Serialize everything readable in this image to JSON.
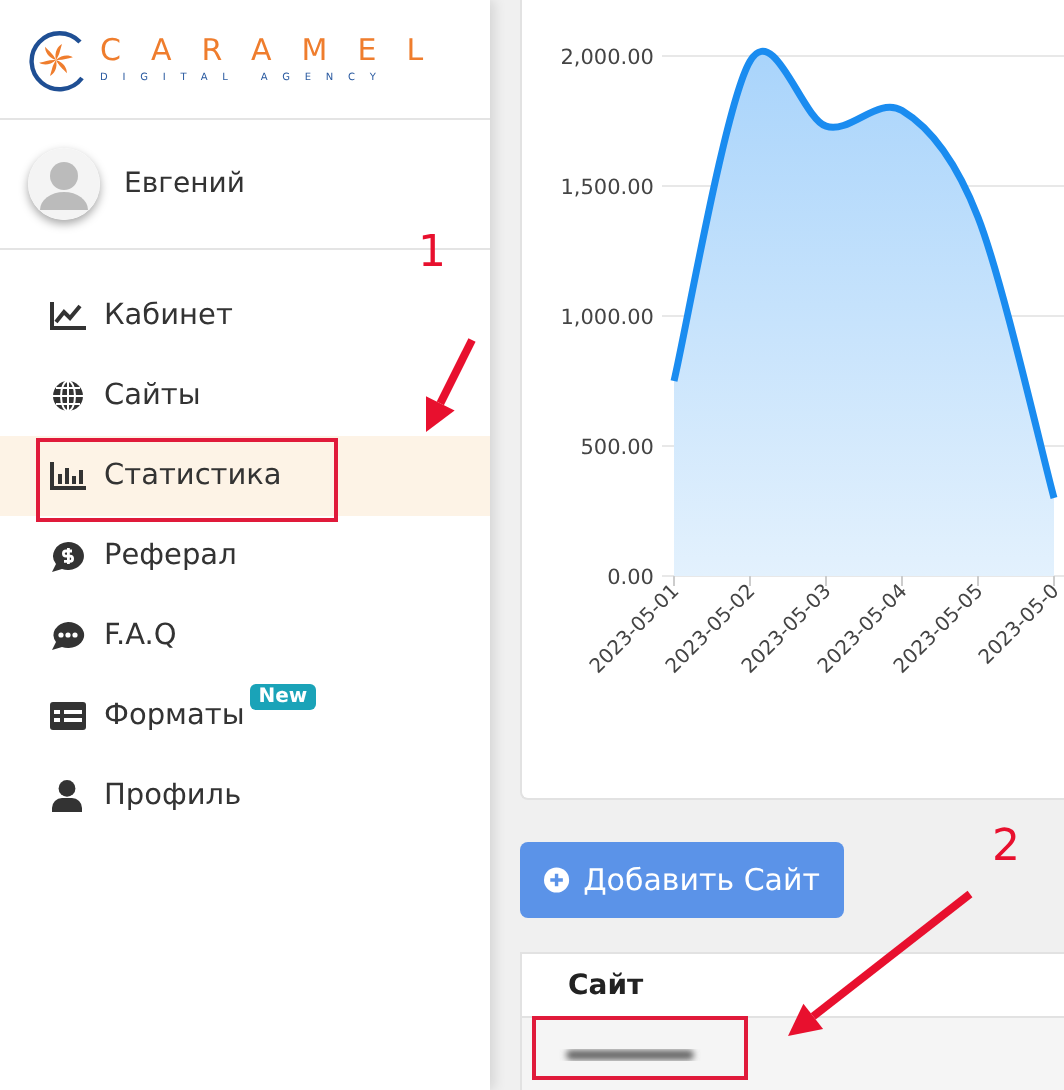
{
  "sidebar": {
    "logo": {
      "name": "CARAMEL",
      "tagline": "DIGITAL AGENCY"
    },
    "user": {
      "name": "Евгений"
    },
    "items": [
      {
        "label": "Кабинет",
        "selected": false
      },
      {
        "label": "Сайты",
        "selected": false
      },
      {
        "label": "Статистика",
        "selected": true
      },
      {
        "label": "Реферал",
        "selected": false
      },
      {
        "label": "F.A.Q",
        "selected": false
      },
      {
        "label": "Форматы",
        "selected": false,
        "badge": "New"
      },
      {
        "label": "Профиль",
        "selected": false
      }
    ]
  },
  "chart": {
    "chart_data": {
      "type": "area",
      "categories": [
        "2023-05-01",
        "2023-05-02",
        "2023-05-03",
        "2023-05-04",
        "2023-05-05",
        "2023-05-0"
      ],
      "grid": true,
      "series": [
        {
          "color": "#1a8cf0",
          "values": [
            750,
            1980,
            1730,
            1790,
            1380,
            300
          ]
        }
      ],
      "ylim": [
        0,
        2000
      ],
      "yticks": [
        {
          "value": 0,
          "label": "0.00"
        },
        {
          "value": 500,
          "label": "500.00"
        },
        {
          "value": 1000,
          "label": "1,000.00"
        },
        {
          "value": 1500,
          "label": "1,500.00"
        },
        {
          "value": 2000,
          "label": "2,000.00"
        }
      ]
    }
  },
  "add_button": {
    "label": "Добавить Сайт"
  },
  "table": {
    "columns": [
      "Сайт"
    ],
    "rows": [
      {
        "redacted": true
      }
    ]
  },
  "annotations": [
    {
      "number": "1"
    },
    {
      "number": "2"
    }
  ]
}
